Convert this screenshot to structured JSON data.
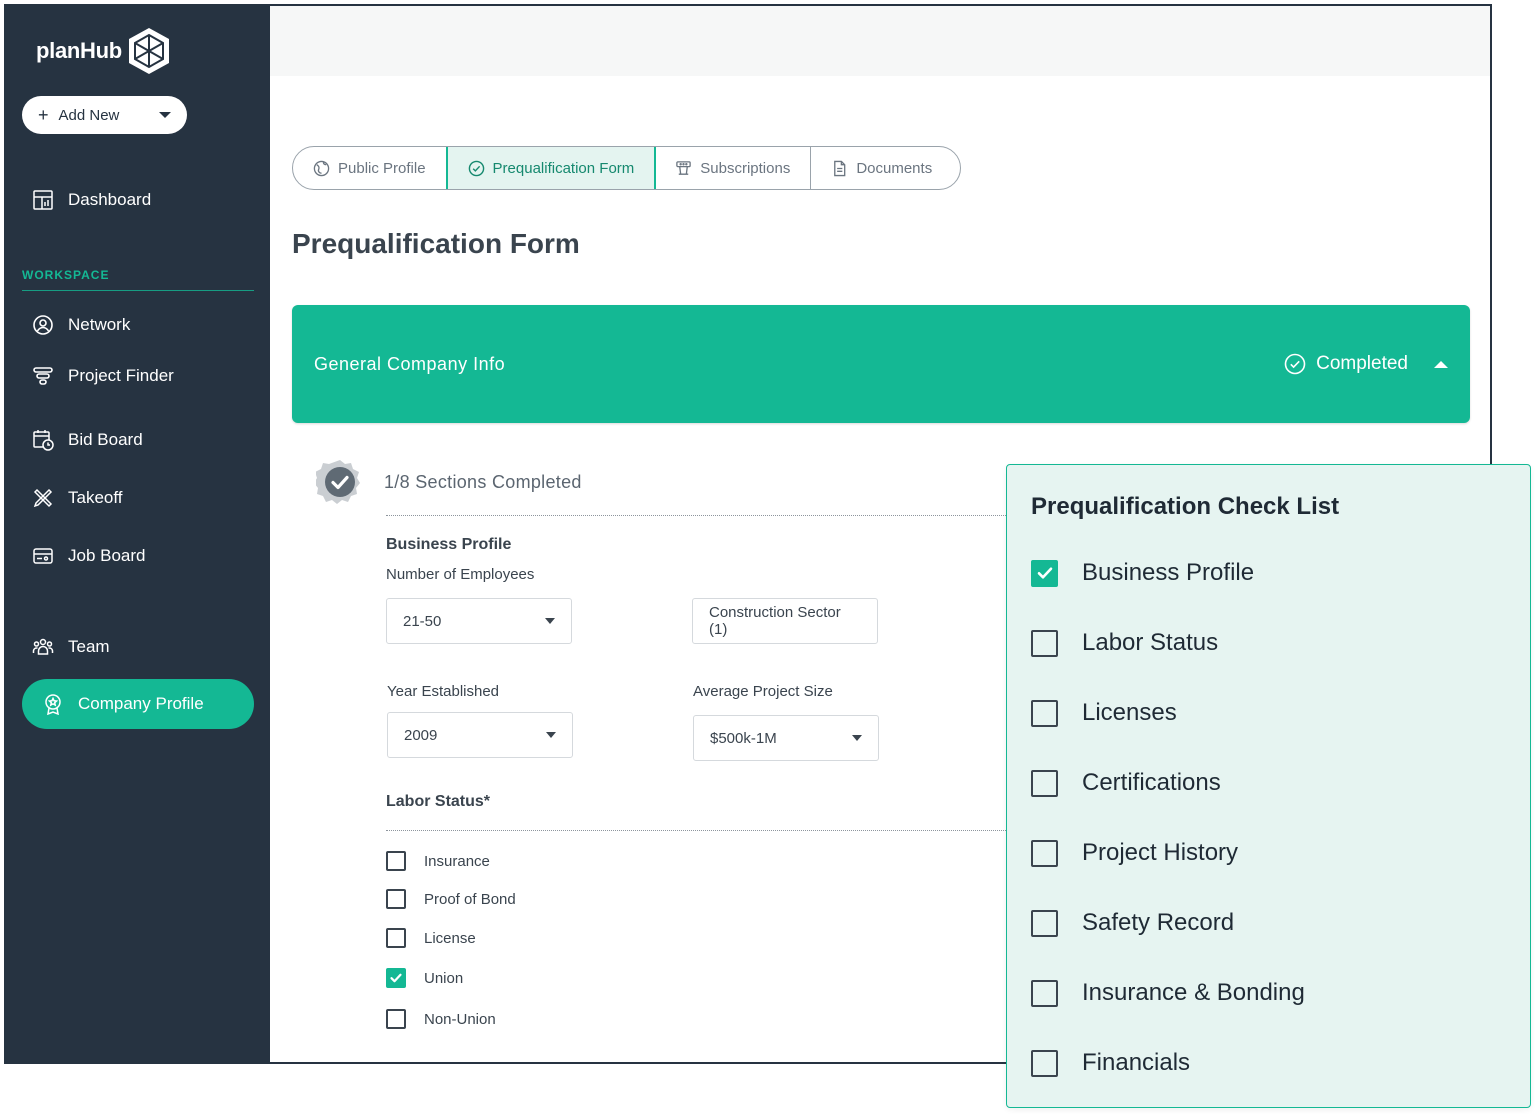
{
  "app": {
    "logo_text": "planHub",
    "logo_icon": "planhub-cube-icon",
    "add_new_label": "Add New",
    "colors": {
      "sidebar": "#263341",
      "accent": "#14b894",
      "accent_light": "#e6f4f1"
    }
  },
  "sidebar": {
    "dashboard": "Dashboard",
    "workspace_label": "WORKSPACE",
    "items": [
      {
        "label": "Network",
        "icon": "user-circle-icon"
      },
      {
        "label": "Project Finder",
        "icon": "filter-icon"
      },
      {
        "label": "Bid Board",
        "icon": "calendar-clock-icon"
      },
      {
        "label": "Takeoff",
        "icon": "ruler-pencil-icon"
      },
      {
        "label": "Job Board",
        "icon": "card-icon"
      },
      {
        "label": "Team",
        "icon": "team-icon"
      },
      {
        "label": "Company Profile",
        "icon": "badge-icon",
        "active": true
      }
    ]
  },
  "tabs": [
    {
      "label": "Public Profile",
      "icon": "globe-icon"
    },
    {
      "label": "Prequalification Form",
      "icon": "check-circle-icon",
      "active": true
    },
    {
      "label": "Subscriptions",
      "icon": "podium-icon"
    },
    {
      "label": "Documents",
      "icon": "document-icon"
    }
  ],
  "page_title": "Prequalification Form",
  "section": {
    "title": "General Company Info",
    "status": "Completed"
  },
  "progress_text": "1/8 Sections Completed",
  "form": {
    "business_profile_heading": "Business Profile",
    "employees_label": "Number of Employees",
    "employees_value": "21-50",
    "sector_value": "Construction Sector (1)",
    "year_label": "Year Established",
    "year_value": "2009",
    "project_size_label": "Average Project Size",
    "project_size_value": "$500k-1M",
    "labor_heading": "Labor Status*",
    "labor_options": [
      {
        "label": "Insurance",
        "checked": false
      },
      {
        "label": "Proof of Bond",
        "checked": false
      },
      {
        "label": "License",
        "checked": false
      },
      {
        "label": "Union",
        "checked": true
      },
      {
        "label": "Non-Union",
        "checked": false
      }
    ]
  },
  "checklist": {
    "title": "Prequalification Check List",
    "items": [
      {
        "label": "Business Profile",
        "checked": true
      },
      {
        "label": "Labor Status",
        "checked": false
      },
      {
        "label": "Licenses",
        "checked": false
      },
      {
        "label": "Certifications",
        "checked": false
      },
      {
        "label": "Project History",
        "checked": false
      },
      {
        "label": "Safety Record",
        "checked": false
      },
      {
        "label": "Insurance & Bonding",
        "checked": false
      },
      {
        "label": "Financials",
        "checked": false
      }
    ]
  }
}
